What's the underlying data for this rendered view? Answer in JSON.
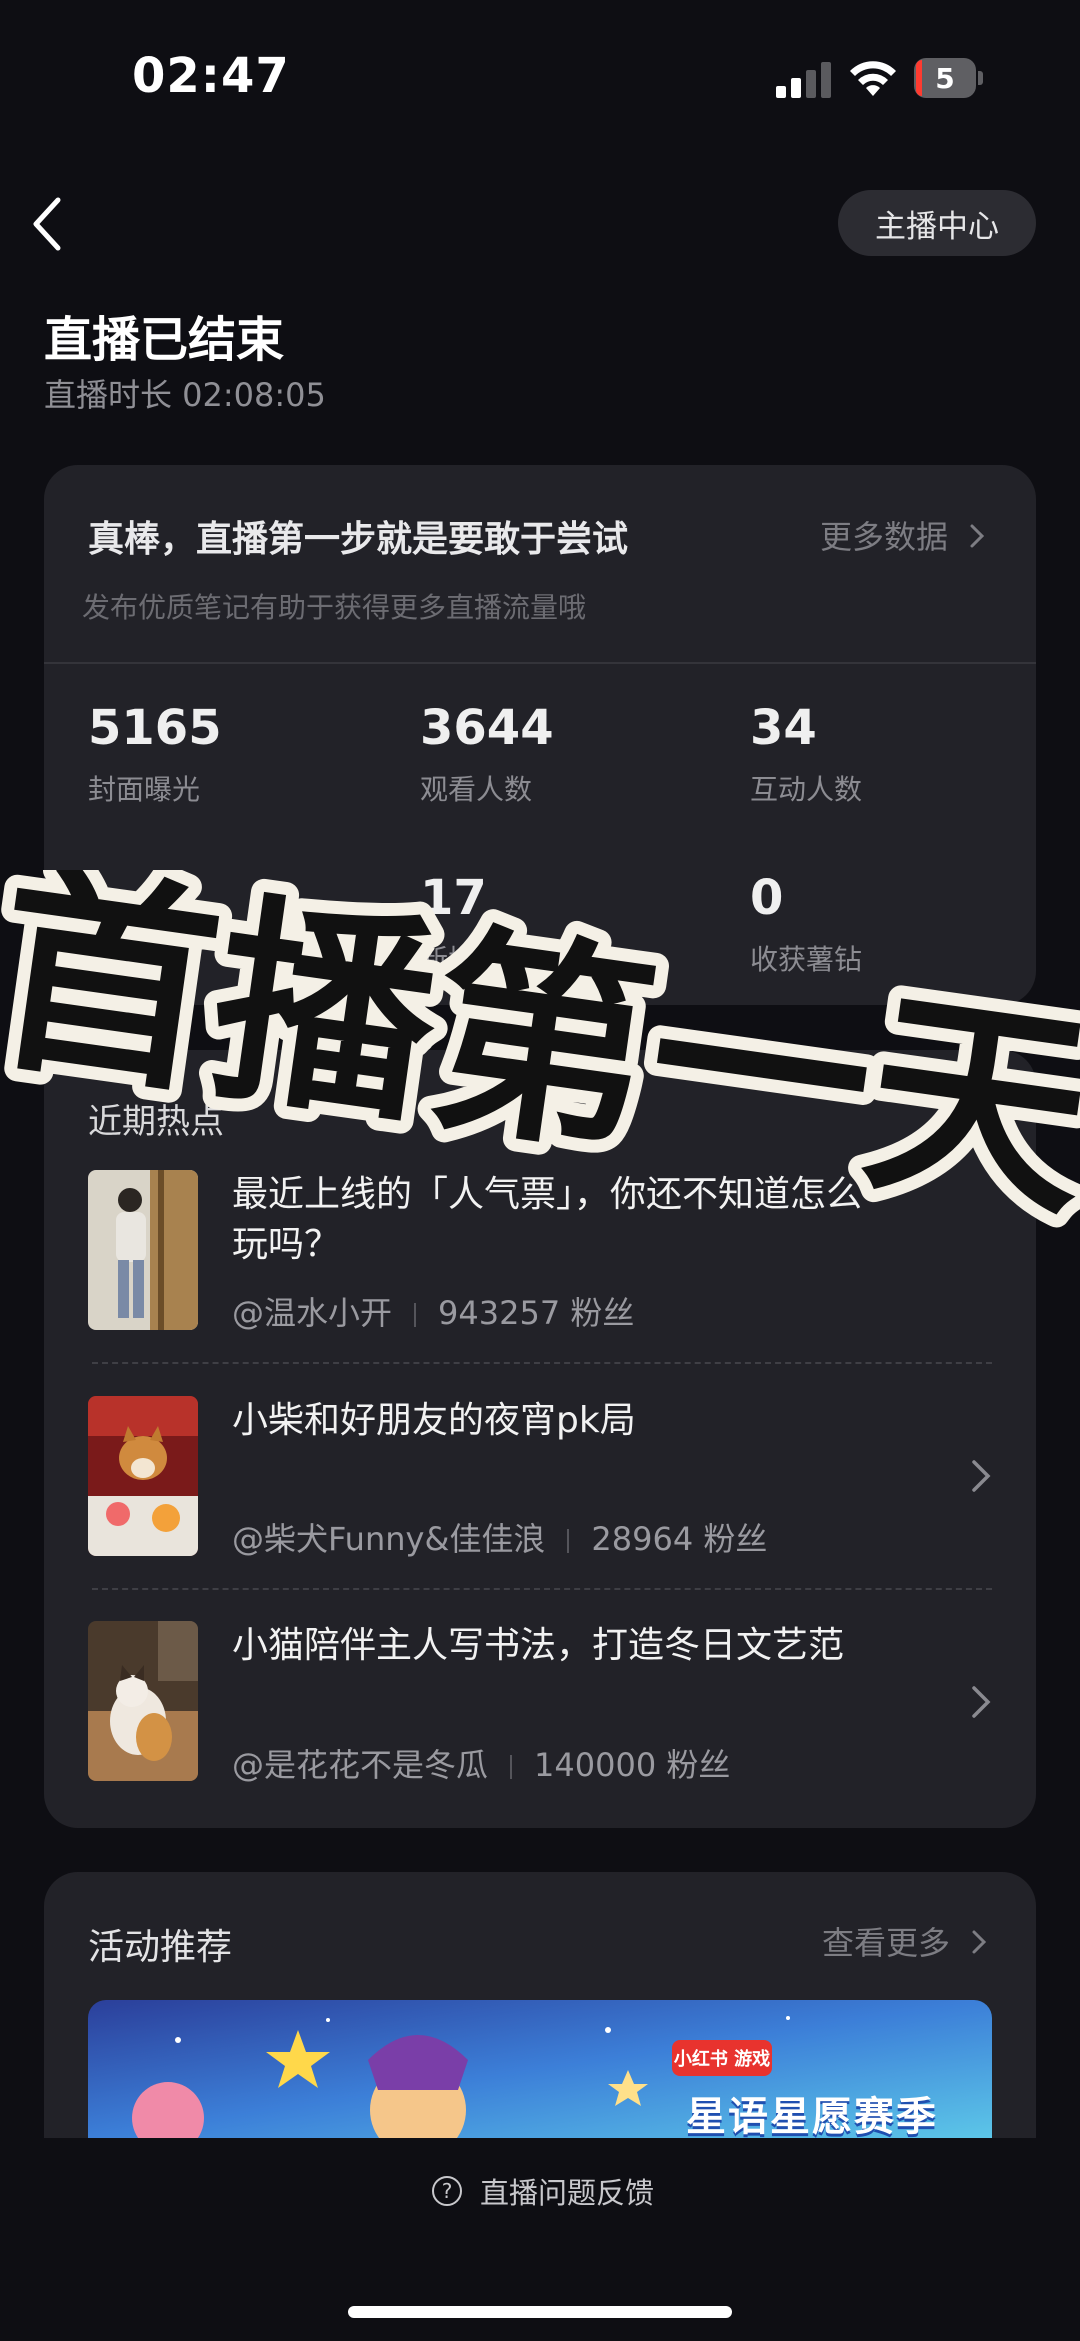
{
  "status_bar": {
    "time": "02:47",
    "battery_level": "5"
  },
  "header": {
    "host_center_label": "主播中心",
    "title": "直播已结束",
    "duration": "直播时长 02:08:05"
  },
  "stats_card": {
    "headline": "真棒，直播第一步就是要敢于尝试",
    "more_data_label": "更多数据",
    "subtitle": "发布优质笔记有助于获得更多直播流量哦",
    "stats": [
      {
        "value": "5165",
        "label": "封面曝光"
      },
      {
        "value": "3644",
        "label": "观看人数"
      },
      {
        "value": "34",
        "label": "互动人数"
      },
      {
        "value": "17",
        "label": "新增粉丝"
      },
      {
        "value": "0",
        "label": "收获薯钻"
      }
    ]
  },
  "hot_topics": {
    "title": "近期热点",
    "items": [
      {
        "title": "最近上线的「人气票」，你还不知道怎么玩吗？",
        "author": "@温水小开",
        "fans": "943257 粉丝"
      },
      {
        "title": "小柴和好朋友的夜宵pk局",
        "author": "@柴犬Funny&佳佳浪",
        "fans": "28964 粉丝"
      },
      {
        "title": "小猫陪伴主人写书法，打造冬日文艺范",
        "author": "@是花花不是冬瓜",
        "fans": "140000 粉丝"
      }
    ]
  },
  "activity": {
    "title": "活动推荐",
    "see_more_label": "查看更多",
    "banner_tag": "小红书 游戏",
    "banner_text": "星语星愿赛季"
  },
  "footer": {
    "feedback_label": "直播问题反馈"
  },
  "overlay_text": "首播第一天"
}
